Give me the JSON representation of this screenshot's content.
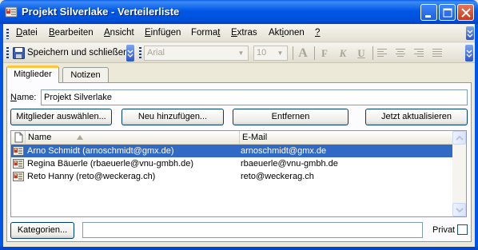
{
  "window": {
    "title": "Projekt Silverlake - Verteilerliste",
    "controls": {
      "minimize": "minimize",
      "maximize": "maximize",
      "close": "close"
    }
  },
  "menu": {
    "items": [
      {
        "label": "Datei"
      },
      {
        "label": "Bearbeiten"
      },
      {
        "label": "Ansicht"
      },
      {
        "label": "Einfügen"
      },
      {
        "label": "Format"
      },
      {
        "label": "Extras"
      },
      {
        "label": "Aktionen"
      },
      {
        "label": "?"
      }
    ]
  },
  "toolbar": {
    "save_label": "Speichern und schließen",
    "font_name": "Arial",
    "font_size": "10",
    "format_buttons": [
      "A",
      "F",
      "K",
      "U"
    ]
  },
  "tabs": [
    {
      "label": "Mitglieder",
      "active": true
    },
    {
      "label": "Notizen",
      "active": false
    }
  ],
  "form": {
    "name_label": "Name:",
    "name_value": "Projekt Silverlake"
  },
  "buttons": {
    "select_members": "Mitglieder auswählen...",
    "add_new": "Neu hinzufügen...",
    "remove": "Entfernen",
    "update_now": "Jetzt aktualisieren",
    "categories": "Kategorien..."
  },
  "members_list": {
    "columns": [
      "Name",
      "E-Mail"
    ],
    "rows": [
      {
        "name": "Arno Schmidt (arnoschmidt@gmx.de)",
        "email": "arnoschmidt@gmx.de",
        "selected": true
      },
      {
        "name": "Regina Bäuerle (rbaeuerle@vnu-gmbh.de)",
        "email": "rbaeuerle@vnu-gmbh.de",
        "selected": false
      },
      {
        "name": "Reto Hanny (reto@weckerag.ch)",
        "email": "reto@weckerag.ch",
        "selected": false
      }
    ]
  },
  "categories_value": "",
  "private": {
    "label": "Privat",
    "checked": false
  },
  "colors": {
    "titlebar": "#0058E6",
    "selection": "#316AC5",
    "tab_highlight": "#FFC83C",
    "window_bg": "#ECE9D8"
  }
}
